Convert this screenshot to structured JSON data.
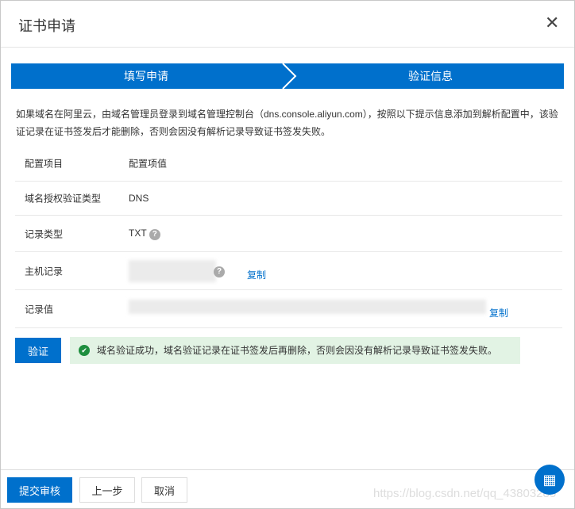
{
  "dialog": {
    "title": "证书申请"
  },
  "steps": [
    "填写申请",
    "验证信息"
  ],
  "instructions": "如果域名在阿里云，由域名管理员登录到域名管理控制台（dns.console.aliyun.com），按照以下提示信息添加到解析配置中，该验证记录在证书签发后才能删除，否则会因没有解析记录导致证书签发失败。",
  "table": {
    "header": {
      "key": "配置项目",
      "value": "配置项值"
    },
    "rows": [
      {
        "key": "域名授权验证类型",
        "value": "DNS"
      },
      {
        "key": "记录类型",
        "value": "TXT"
      },
      {
        "key": "主机记录",
        "value": "",
        "copy": "复制"
      },
      {
        "key": "记录值",
        "value": "",
        "copy": "复制"
      }
    ]
  },
  "verify_label": "验证",
  "success_message": "域名验证成功，域名验证记录在证书签发后再删除，否则会因没有解析记录导致证书签发失败。",
  "footer": {
    "submit": "提交审核",
    "prev": "上一步",
    "cancel": "取消"
  },
  "watermark": "https://blog.csdn.net/qq_43803285",
  "colors": {
    "primary": "#0070cc",
    "success_bg": "#e2f3e4"
  }
}
